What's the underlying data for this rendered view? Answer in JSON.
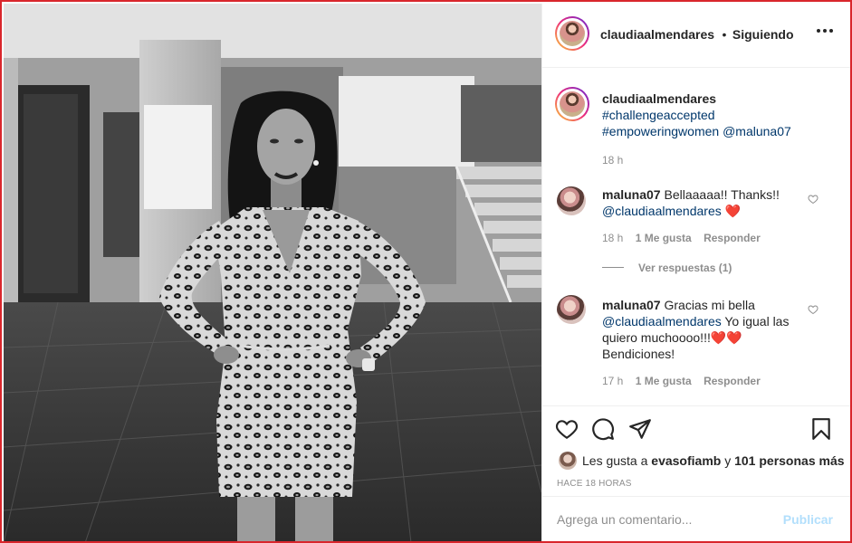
{
  "post": {
    "username": "claudiaalmendares",
    "separator": "•",
    "follow_status": "Siguiendo",
    "more_icon": "more-horizontal-icon"
  },
  "caption": {
    "username": "claudiaalmendares",
    "tag1": "#challengeaccepted",
    "tag2": "#empoweringwomen",
    "mention": "@maluna07",
    "time": "18 h"
  },
  "comments": [
    {
      "username": "maluna07",
      "text_line1": "Bellaaaaa!! Thanks!!",
      "mention": "@claudiaalmendares",
      "emoji": "❤️",
      "time": "18 h",
      "likes": "1 Me gusta",
      "reply": "Responder",
      "view_replies": "Ver respuestas (1)"
    },
    {
      "username": "maluna07",
      "text_line1": "Gracias mi bella",
      "mention": "@claudiaalmendares",
      "text_after_mention": " Yo igual las",
      "text_line3": "quiero muchoooo!!!",
      "emoji": "❤️❤️",
      "text_line4": "Bendiciones!",
      "time": "17 h",
      "likes": "1 Me gusta",
      "reply": "Responder"
    }
  ],
  "likes_line": {
    "prefix": "Les gusta a ",
    "user": "evasofiamb",
    "connector": " y ",
    "others": "101 personas más"
  },
  "timestamp": "HACE 18 HORAS",
  "comment_box": {
    "placeholder": "Agrega un comentario...",
    "publish_label": "Publicar"
  },
  "colors": {
    "frame_border": "#d9262c",
    "link": "#00376b",
    "muted": "#8e8e8e",
    "heart": "#ed4956",
    "publish_disabled": "#b2dffc"
  }
}
